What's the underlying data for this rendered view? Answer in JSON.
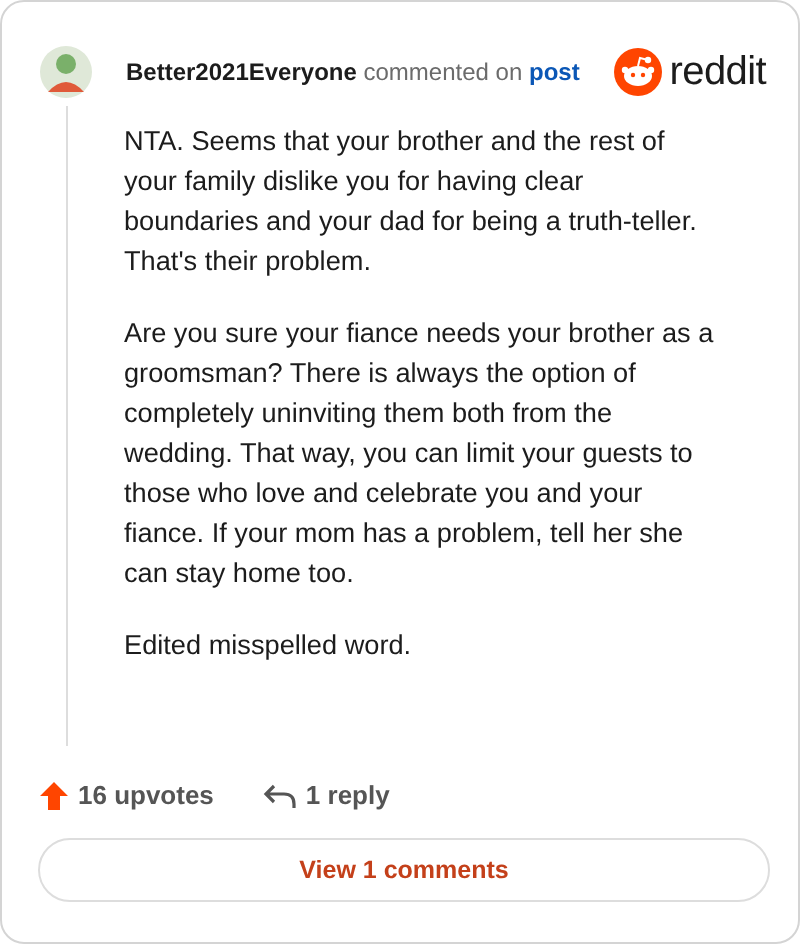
{
  "comment": {
    "author": "Better2021Everyone",
    "action": "commented on",
    "link": "post",
    "brand": "reddit",
    "paragraphs": [
      "NTA. Seems that your brother and the rest of your family dislike you for having clear boundaries and your dad for being a truth-teller. That's their problem.",
      "Are you sure your fiance needs your brother as a groomsman? There is always the option of completely uninviting them both from the wedding. That way, you can limit your guests to those who love and celebrate you and your fiance. If your mom has a problem, tell her she can stay home too.",
      "Edited misspelled word."
    ],
    "upvotes": "16 upvotes",
    "upvoted": true,
    "replies": "1 reply"
  },
  "view_button": "View 1 comments"
}
